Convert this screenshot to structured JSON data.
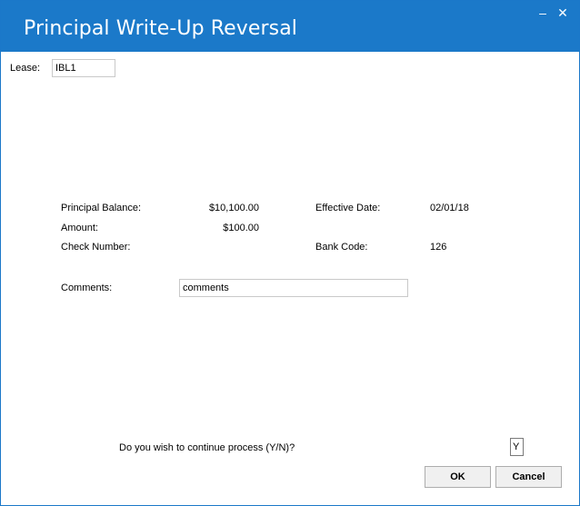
{
  "window": {
    "title": "Principal Write-Up Reversal",
    "minimize_label": "–",
    "close_label": "✕"
  },
  "lease": {
    "label": "Lease:",
    "value": "IBL1"
  },
  "fields": {
    "principal_balance_label": "Principal Balance:",
    "principal_balance_value": "$10,100.00",
    "amount_label": "Amount:",
    "amount_value": "$100.00",
    "check_number_label": "Check Number:",
    "effective_date_label": "Effective Date:",
    "effective_date_value": "02/01/18",
    "bank_code_label": "Bank Code:",
    "bank_code_value": "126"
  },
  "comments": {
    "label": "Comments:",
    "value": "comments"
  },
  "prompt": {
    "question": "Do you wish to continue process (Y/N)?",
    "answer": "Y"
  },
  "buttons": {
    "ok_label": "OK",
    "cancel_label": "Cancel"
  }
}
